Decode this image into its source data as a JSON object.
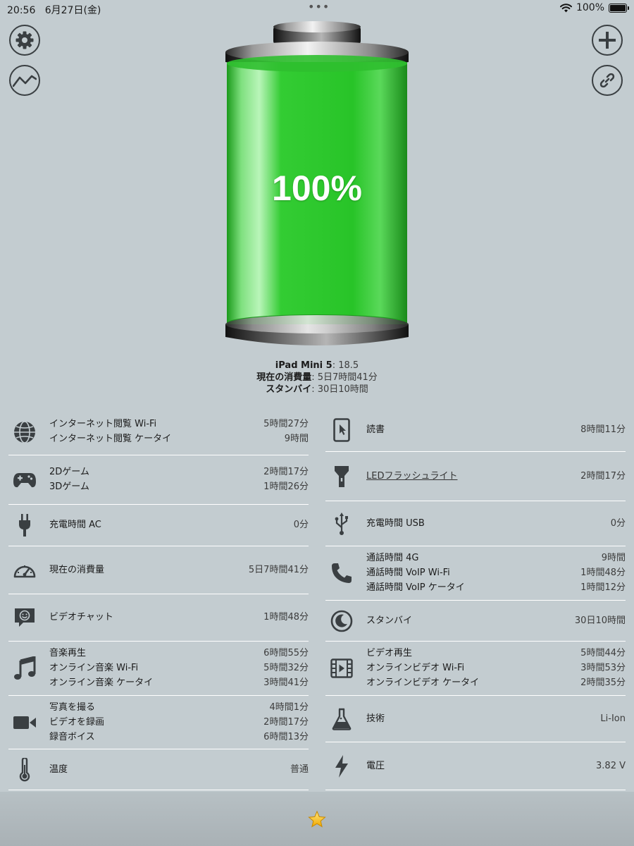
{
  "status_bar": {
    "time": "20:56",
    "date": "6月27日(金)",
    "battery": "100%",
    "dots": "•••"
  },
  "top_buttons": {
    "settings": "gear-icon",
    "chart": "chart-icon",
    "add": "plus-icon",
    "link": "link-icon"
  },
  "battery": {
    "percent": "100%",
    "level": 1.0,
    "color": "#2ecc2e"
  },
  "device": {
    "model_label": "iPad Mini 5",
    "model_value": ": 18.5",
    "usage_label": "現在の消費量",
    "usage_value": ": 5日7時間41分",
    "standby_label": "スタンバイ",
    "standby_value": ": 30日10時間"
  },
  "left_rows": [
    {
      "icon": "globe-icon",
      "lines": [
        {
          "label": "インターネット閲覧 Wi-Fi",
          "value": "5時間27分"
        },
        {
          "label": "インターネット閲覧 ケータイ",
          "value": "9時間"
        }
      ]
    },
    {
      "icon": "gamepad-icon",
      "lines": [
        {
          "label": "2Dゲーム",
          "value": "2時間17分"
        },
        {
          "label": "3Dゲーム",
          "value": "1時間26分"
        }
      ]
    },
    {
      "icon": "plug-icon",
      "lines": [
        {
          "label": "充電時間 AC",
          "value": "0分"
        }
      ]
    },
    {
      "icon": "gauge-icon",
      "lines": [
        {
          "label": "現在の消費量",
          "value": "5日7時間41分"
        }
      ]
    },
    {
      "icon": "video-chat-icon",
      "lines": [
        {
          "label": "ビデオチャット",
          "value": "1時間48分"
        }
      ]
    },
    {
      "icon": "music-icon",
      "lines": [
        {
          "label": "音楽再生",
          "value": "6時間55分"
        },
        {
          "label": "オンライン音楽 Wi-Fi",
          "value": "5時間32分"
        },
        {
          "label": "オンライン音楽 ケータイ",
          "value": "3時間41分"
        }
      ]
    },
    {
      "icon": "camera-icon",
      "lines": [
        {
          "label": "写真を撮る",
          "value": "4時間1分"
        },
        {
          "label": "ビデオを録画",
          "value": "2時間17分"
        },
        {
          "label": "録音ボイス",
          "value": "6時間13分"
        }
      ]
    },
    {
      "icon": "thermometer-icon",
      "lines": [
        {
          "label": "温度",
          "value": "普通"
        }
      ]
    }
  ],
  "right_rows": [
    {
      "icon": "tablet-icon",
      "lines": [
        {
          "label": "読書",
          "value": "8時間11分"
        }
      ]
    },
    {
      "icon": "flashlight-icon",
      "lines": [
        {
          "label": "LEDフラッシュライト",
          "value": "2時間17分"
        }
      ]
    },
    {
      "icon": "usb-icon",
      "lines": [
        {
          "label": "充電時間 USB",
          "value": "0分"
        }
      ]
    },
    {
      "icon": "phone-icon",
      "lines": [
        {
          "label": "通話時間 4G",
          "value": "9時間"
        },
        {
          "label": "通話時間 VoIP Wi-Fi",
          "value": "1時間48分"
        },
        {
          "label": "通話時間 VoIP ケータイ",
          "value": "1時間12分"
        }
      ]
    },
    {
      "icon": "moon-icon",
      "lines": [
        {
          "label": "スタンバイ",
          "value": "30日10時間"
        }
      ]
    },
    {
      "icon": "film-icon",
      "lines": [
        {
          "label": "ビデオ再生",
          "value": "5時間44分"
        },
        {
          "label": "オンラインビデオ Wi-Fi",
          "value": "3時間53分"
        },
        {
          "label": "オンラインビデオ ケータイ",
          "value": "2時間35分"
        }
      ]
    },
    {
      "icon": "flask-icon",
      "lines": [
        {
          "label": "技術",
          "value": "Li-Ion"
        }
      ]
    },
    {
      "icon": "bolt-icon",
      "lines": [
        {
          "label": "電圧",
          "value": "3.82 V"
        }
      ]
    }
  ],
  "bottom": {
    "star_icon": "star-icon"
  }
}
